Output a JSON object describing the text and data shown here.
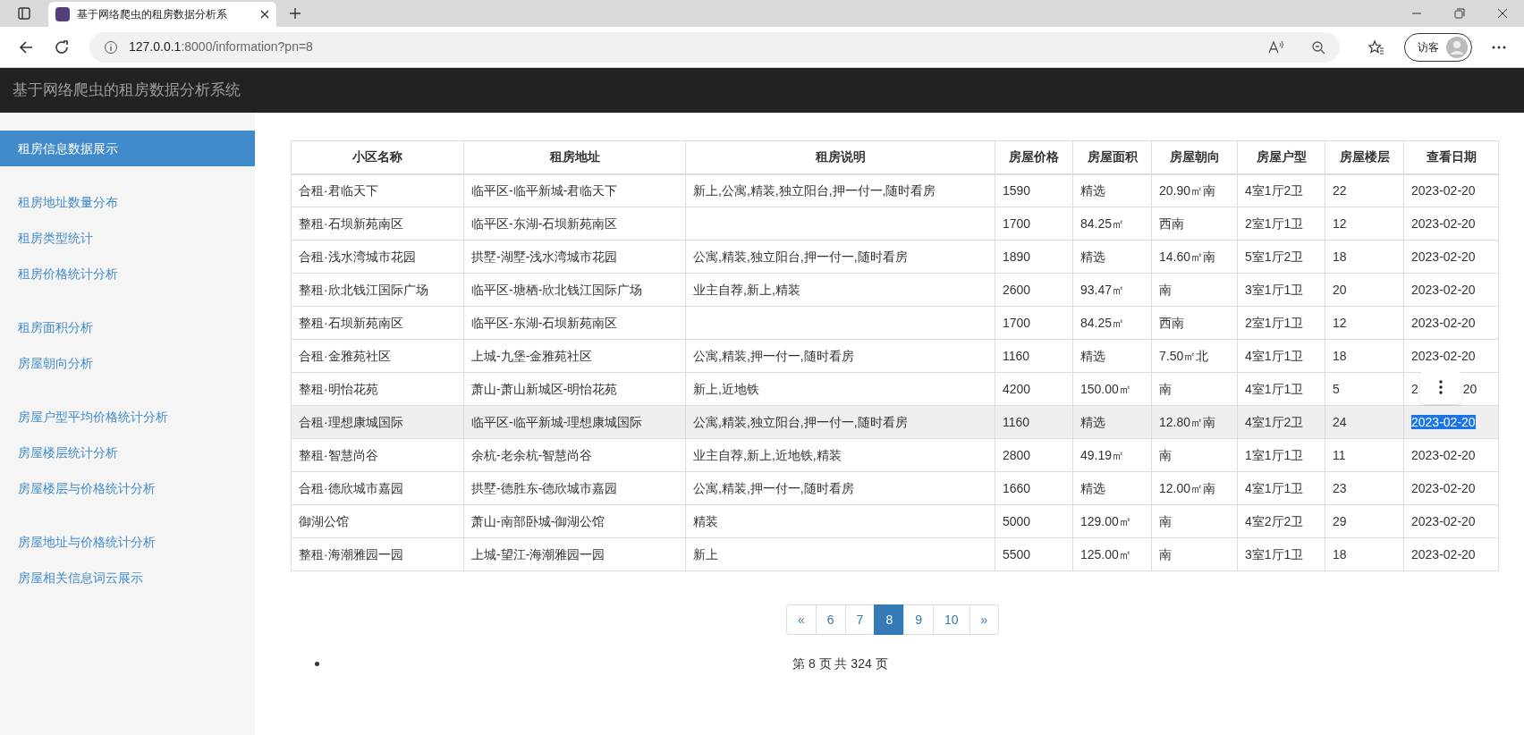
{
  "browser": {
    "tab_title": "基于网络爬虫的租房数据分析系",
    "url_host": "127.0.0.1",
    "url_rest": ":8000/information?pn=8",
    "profile": "访客"
  },
  "navbar": {
    "brand": "基于网络爬虫的租房数据分析系统"
  },
  "sidebar": {
    "groups": [
      [
        {
          "label": "租房信息数据展示",
          "selected": true
        }
      ],
      [
        {
          "label": "租房地址数量分布",
          "selected": false
        },
        {
          "label": "租房类型统计",
          "selected": false
        },
        {
          "label": "租房价格统计分析",
          "selected": false
        }
      ],
      [
        {
          "label": "租房面积分析",
          "selected": false
        },
        {
          "label": "房屋朝向分析",
          "selected": false
        }
      ],
      [
        {
          "label": "房屋户型平均价格统计分析",
          "selected": false
        },
        {
          "label": "房屋楼层统计分析",
          "selected": false
        },
        {
          "label": "房屋楼层与价格统计分析",
          "selected": false
        }
      ],
      [
        {
          "label": "房屋地址与价格统计分析",
          "selected": false
        },
        {
          "label": "房屋相关信息词云展示",
          "selected": false
        }
      ]
    ]
  },
  "table": {
    "columns": [
      "小区名称",
      "租房地址",
      "租房说明",
      "房屋价格",
      "房屋面积",
      "房屋朝向",
      "房屋户型",
      "房屋楼层",
      "查看日期"
    ],
    "rows": [
      {
        "cells": [
          "合租·君临天下",
          "临平区-临平新城-君临天下",
          "新上,公寓,精装,独立阳台,押一付一,随时看房",
          "1590",
          "精选",
          "20.90㎡南",
          "4室1厅2卫",
          "22"
        ],
        "date": "2023-02-20",
        "hovered": false,
        "date_selected": false
      },
      {
        "cells": [
          "整租·石坝新苑南区",
          "临平区-东湖-石坝新苑南区",
          "",
          "1700",
          "84.25㎡",
          "西南",
          "2室1厅1卫",
          "12"
        ],
        "date": "2023-02-20",
        "hovered": false,
        "date_selected": false
      },
      {
        "cells": [
          "合租·浅水湾城市花园",
          "拱墅-湖墅-浅水湾城市花园",
          "公寓,精装,独立阳台,押一付一,随时看房",
          "1890",
          "精选",
          "14.60㎡南",
          "5室1厅2卫",
          "18"
        ],
        "date": "2023-02-20",
        "hovered": false,
        "date_selected": false
      },
      {
        "cells": [
          "整租·欣北钱江国际广场",
          "临平区-塘栖-欣北钱江国际广场",
          "业主自荐,新上,精装",
          "2600",
          "93.47㎡",
          "南",
          "3室1厅1卫",
          "20"
        ],
        "date": "2023-02-20",
        "hovered": false,
        "date_selected": false
      },
      {
        "cells": [
          "整租·石坝新苑南区",
          "临平区-东湖-石坝新苑南区",
          "",
          "1700",
          "84.25㎡",
          "西南",
          "2室1厅1卫",
          "12"
        ],
        "date": "2023-02-20",
        "hovered": false,
        "date_selected": false
      },
      {
        "cells": [
          "合租·金雅苑社区",
          "上城-九堡-金雅苑社区",
          "公寓,精装,押一付一,随时看房",
          "1160",
          "精选",
          "7.50㎡北",
          "4室1厅1卫",
          "18"
        ],
        "date": "2023-02-20",
        "hovered": false,
        "date_selected": false
      },
      {
        "cells": [
          "整租·明怡花苑",
          "萧山-萧山新城区-明怡花苑",
          "新上,近地铁",
          "4200",
          "150.00㎡",
          "南",
          "4室1厅1卫",
          "5"
        ],
        "date_fragments": [
          "2",
          "20"
        ],
        "menu_popup": true,
        "hovered": false
      },
      {
        "cells": [
          "合租·理想康城国际",
          "临平区-临平新城-理想康城国际",
          "公寓,精装,独立阳台,押一付一,随时看房",
          "1160",
          "精选",
          "12.80㎡南",
          "4室1厅2卫",
          "24"
        ],
        "date": "2023-02-20",
        "hovered": true,
        "date_selected": true
      },
      {
        "cells": [
          "整租·智慧尚谷",
          "余杭-老余杭-智慧尚谷",
          "业主自荐,新上,近地铁,精装",
          "2800",
          "49.19㎡",
          "南",
          "1室1厅1卫",
          "11"
        ],
        "date": "2023-02-20",
        "hovered": false,
        "date_selected": false
      },
      {
        "cells": [
          "合租·德欣城市嘉园",
          "拱墅-德胜东-德欣城市嘉园",
          "公寓,精装,押一付一,随时看房",
          "1660",
          "精选",
          "12.00㎡南",
          "4室1厅1卫",
          "23"
        ],
        "date": "2023-02-20",
        "hovered": false,
        "date_selected": false
      },
      {
        "cells": [
          "御湖公馆",
          "萧山-南部卧城-御湖公馆",
          "精装",
          "5000",
          "129.00㎡",
          "南",
          "4室2厅2卫",
          "29"
        ],
        "date": "2023-02-20",
        "hovered": false,
        "date_selected": false
      },
      {
        "cells": [
          "整租·海潮雅园一园",
          "上城-望江-海潮雅园一园",
          "新上",
          "5500",
          "125.00㎡",
          "南",
          "3室1厅1卫",
          "18"
        ],
        "date": "2023-02-20",
        "hovered": false,
        "date_selected": false
      }
    ]
  },
  "pagination": [
    {
      "label": "«",
      "selected": false
    },
    {
      "label": "6",
      "selected": false
    },
    {
      "label": "7",
      "selected": false
    },
    {
      "label": "8",
      "selected": true
    },
    {
      "label": "9",
      "selected": false
    },
    {
      "label": "10",
      "selected": false
    },
    {
      "label": "»",
      "selected": false
    }
  ],
  "page_info": "第 8 页 共 324 页"
}
